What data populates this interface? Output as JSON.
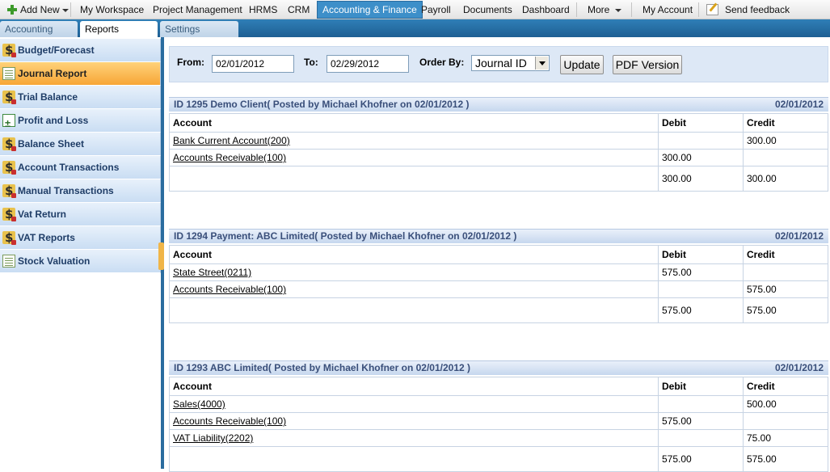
{
  "topnav": {
    "add_new": "Add New",
    "items": [
      "My Workspace",
      "Project Management",
      "HRMS",
      "CRM",
      "Accounting & Finance",
      "Payroll",
      "Documents",
      "Dashboard"
    ],
    "more": "More",
    "my_account": "My Account",
    "send_feedback": "Send feedback"
  },
  "subtabs": [
    "Accounting",
    "Reports",
    "Settings"
  ],
  "sidebar": {
    "items": [
      {
        "label": "Budget/Forecast",
        "icon": "dollar-icon"
      },
      {
        "label": "Journal Report",
        "icon": "sheet-icon"
      },
      {
        "label": "Trial Balance",
        "icon": "dollar-icon"
      },
      {
        "label": "Profit and Loss",
        "icon": "profit-loss-icon"
      },
      {
        "label": "Balance Sheet",
        "icon": "dollar-icon"
      },
      {
        "label": "Account Transactions",
        "icon": "dollar-icon"
      },
      {
        "label": "Manual Transactions",
        "icon": "dollar-icon"
      },
      {
        "label": "Vat Return",
        "icon": "dollar-icon"
      },
      {
        "label": "VAT Reports",
        "icon": "dollar-icon"
      },
      {
        "label": "Stock Valuation",
        "icon": "sheet-icon"
      }
    ]
  },
  "filter": {
    "from_label": "From:",
    "from_value": "02/01/2012",
    "to_label": "To:",
    "to_value": "02/29/2012",
    "order_label": "Order By:",
    "order_value": "Journal ID",
    "update_label": "Update",
    "pdf_label": "PDF Version"
  },
  "columns": {
    "account": "Account",
    "debit": "Debit",
    "credit": "Credit"
  },
  "journals": [
    {
      "title": "ID 1295 Demo Client( Posted by Michael Khofner on 02/01/2012 )",
      "date": "02/01/2012",
      "rows": [
        {
          "account": "Bank Current Account(200)",
          "debit": "",
          "credit": "300.00"
        },
        {
          "account": "Accounts Receivable(100)",
          "debit": "300.00",
          "credit": ""
        }
      ],
      "total": {
        "debit": "300.00",
        "credit": "300.00"
      }
    },
    {
      "title": "ID 1294 Payment: ABC Limited( Posted by Michael Khofner on 02/01/2012 )",
      "date": "02/01/2012",
      "rows": [
        {
          "account": "State Street(0211)",
          "debit": "575.00",
          "credit": ""
        },
        {
          "account": "Accounts Receivable(100)",
          "debit": "",
          "credit": "575.00"
        }
      ],
      "total": {
        "debit": "575.00",
        "credit": "575.00"
      }
    },
    {
      "title": "ID 1293 ABC Limited( Posted by Michael Khofner on 02/01/2012 )",
      "date": "02/01/2012",
      "rows": [
        {
          "account": "Sales(4000)",
          "debit": "",
          "credit": "500.00"
        },
        {
          "account": "Accounts Receivable(100)",
          "debit": "575.00",
          "credit": ""
        },
        {
          "account": "VAT Liability(2202)",
          "debit": "",
          "credit": "75.00"
        }
      ],
      "total": {
        "debit": "575.00",
        "credit": "575.00"
      }
    }
  ]
}
